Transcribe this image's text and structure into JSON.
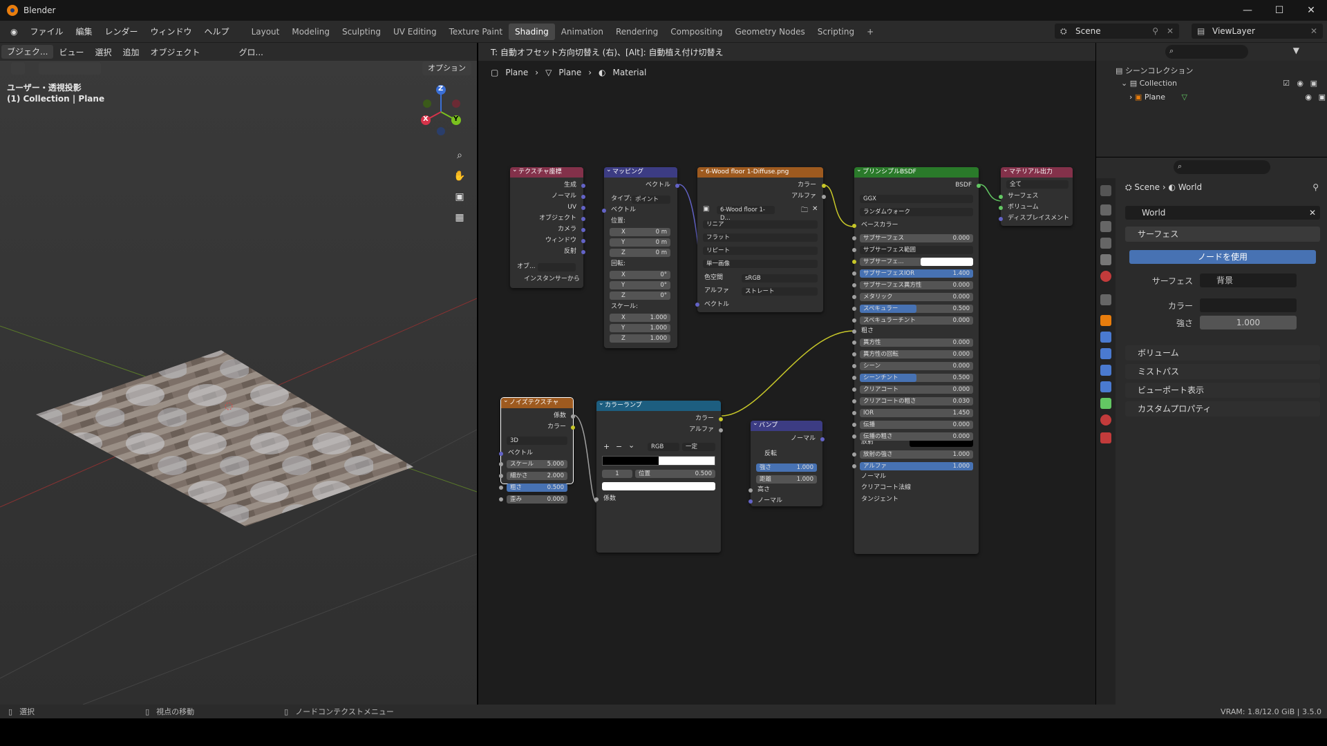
{
  "window": {
    "title": "Blender",
    "minimize": "—",
    "maximize": "☐",
    "close": "✕"
  },
  "menu": [
    "ファイル",
    "編集",
    "レンダー",
    "ウィンドウ",
    "ヘルプ"
  ],
  "workspaces": [
    {
      "label": "Layout",
      "active": false
    },
    {
      "label": "Modeling",
      "active": false
    },
    {
      "label": "Sculpting",
      "active": false
    },
    {
      "label": "UV Editing",
      "active": false
    },
    {
      "label": "Texture Paint",
      "active": false
    },
    {
      "label": "Shading",
      "active": true
    },
    {
      "label": "Animation",
      "active": false
    },
    {
      "label": "Rendering",
      "active": false
    },
    {
      "label": "Compositing",
      "active": false
    },
    {
      "label": "Geometry Nodes",
      "active": false
    },
    {
      "label": "Scripting",
      "active": false
    }
  ],
  "add_workspace": "+",
  "scene": {
    "name": "Scene",
    "view_layer": "ViewLayer"
  },
  "viewport": {
    "mode": "ブジェク...",
    "menus": [
      "ビュー",
      "選択",
      "追加",
      "オブジェクト"
    ],
    "transform": "グロ...",
    "options": "オプション",
    "view_label": "ユーザー・透視投影",
    "collection_label": "(1) Collection | Plane",
    "gizmo": {
      "z": "Z",
      "y": "Y",
      "x": "X"
    }
  },
  "node_editor": {
    "hint": "T: 自動オフセット方向切替え (右)、[Alt]: 自動植え付け切替え",
    "breadcrumb": [
      "Plane",
      "Plane",
      "Material"
    ],
    "nodes": {
      "texcoord": {
        "title": "テクスチャ座標",
        "outputs": [
          "生成",
          "ノーマル",
          "UV",
          "オブジェクト",
          "カメラ",
          "ウィンドウ",
          "反射"
        ],
        "object_label": "オブ...",
        "from_instancer": "インスタンサーから"
      },
      "mapping": {
        "title": "マッピング",
        "out": "ベクトル",
        "type_label": "タイプ:",
        "type_value": "ポイント",
        "vector": "ベクトル",
        "location": "位置:",
        "loc": [
          {
            "axis": "X",
            "val": "0 m"
          },
          {
            "axis": "Y",
            "val": "0 m"
          },
          {
            "axis": "Z",
            "val": "0 m"
          }
        ],
        "rotation": "回転:",
        "rot": [
          {
            "axis": "X",
            "val": "0°"
          },
          {
            "axis": "Y",
            "val": "0°"
          },
          {
            "axis": "Z",
            "val": "0°"
          }
        ],
        "scale": "スケール:",
        "scl": [
          {
            "axis": "X",
            "val": "1.000"
          },
          {
            "axis": "Y",
            "val": "1.000"
          },
          {
            "axis": "Z",
            "val": "1.000"
          }
        ]
      },
      "image": {
        "title": "6-Wood floor 1-Diffuse.png",
        "out_color": "カラー",
        "out_alpha": "アルファ",
        "file": "6-Wood floor 1-D...",
        "interp": "リニア",
        "proj": "フラット",
        "ext": "リピート",
        "source": "単一画像",
        "colorspace_label": "色空間",
        "colorspace": "sRGB",
        "alpha_label": "アルファ",
        "alpha": "ストレート",
        "vector": "ベクトル"
      },
      "bsdf": {
        "title": "プリンシプルBSDF",
        "out": "BSDF",
        "dist": "GGX",
        "sss_method": "ランダムウォーク",
        "base_color": "ベースカラー",
        "fields": [
          {
            "label": "サブサーフェス",
            "val": "0.000",
            "blue": false
          },
          {
            "label": "サブサーフェス範囲",
            "val": "",
            "blue": false,
            "dd": true
          },
          {
            "label": "サブサーフェ...",
            "val": "",
            "blue": false,
            "white": true
          },
          {
            "label": "サブサーフェスIOR",
            "val": "1.400",
            "blue": true
          },
          {
            "label": "サブサーフェス異方性",
            "val": "0.000",
            "blue": false
          },
          {
            "label": "メタリック",
            "val": "0.000",
            "blue": false
          },
          {
            "label": "スペキュラー",
            "val": "0.500",
            "blue": true,
            "half": true
          },
          {
            "label": "スペキュラーチント",
            "val": "0.000",
            "blue": false
          }
        ],
        "roughness": "粗さ",
        "fields2": [
          {
            "label": "異方性",
            "val": "0.000",
            "blue": false
          },
          {
            "label": "異方性の回転",
            "val": "0.000",
            "blue": false
          },
          {
            "label": "シーン",
            "val": "0.000",
            "blue": false
          },
          {
            "label": "シーンチント",
            "val": "0.500",
            "blue": true,
            "half": true
          },
          {
            "label": "クリアコート",
            "val": "0.000",
            "blue": false
          },
          {
            "label": "クリアコートの粗さ",
            "val": "0.030",
            "blue": false
          },
          {
            "label": "IOR",
            "val": "1.450",
            "blue": false
          },
          {
            "label": "伝播",
            "val": "0.000",
            "blue": false
          },
          {
            "label": "伝播の粗さ",
            "val": "0.000",
            "blue": false
          }
        ],
        "emission": "放射",
        "fields3": [
          {
            "label": "放射の強さ",
            "val": "1.000",
            "blue": false
          },
          {
            "label": "アルファ",
            "val": "1.000",
            "blue": true
          }
        ],
        "normal": "ノーマル",
        "cc_normal": "クリアコート法線",
        "tangent": "タンジェント"
      },
      "output": {
        "title": "マテリアル出力",
        "target": "全て",
        "inputs": [
          "サーフェス",
          "ボリューム",
          "ディスプレイスメント"
        ]
      },
      "noise": {
        "title": "ノイズテクスチャ",
        "out_fac": "係数",
        "out_color": "カラー",
        "dim": "3D",
        "vector": "ベクトル",
        "fields": [
          {
            "label": "スケール",
            "val": "5.000"
          },
          {
            "label": "細かさ",
            "val": "2.000"
          },
          {
            "label": "粗さ",
            "val": "0.500"
          },
          {
            "label": "歪み",
            "val": "0.000"
          }
        ]
      },
      "ramp": {
        "title": "カラーランプ",
        "out_color": "カラー",
        "out_alpha": "アルファ",
        "add": "+",
        "remove": "−",
        "menu": "⌄",
        "mode": "RGB",
        "interp": "一定",
        "index": "1",
        "pos_label": "位置",
        "pos": "0.500",
        "fac": "係数"
      },
      "bump": {
        "title": "バンプ",
        "out": "ノーマル",
        "invert": "反転",
        "strength_label": "強さ",
        "strength": "1.000",
        "distance_label": "距離",
        "distance": "1.000",
        "height": "高さ",
        "normal": "ノーマル"
      }
    }
  },
  "outliner": {
    "root": "シーンコレクション",
    "collection": "Collection",
    "object": "Plane"
  },
  "properties": {
    "breadcrumb_scene": "Scene",
    "breadcrumb_world": "World",
    "world_name": "World",
    "surface_header": "サーフェス",
    "use_nodes": "ノードを使用",
    "surface_label": "サーフェス",
    "surface_value": "背景",
    "color_label": "カラー",
    "strength_label": "強さ",
    "strength_value": "1.000",
    "sections": [
      "ボリューム",
      "ミストパス",
      "ビューポート表示",
      "カスタムプロパティ"
    ]
  },
  "status": {
    "select": "選択",
    "move_view": "視点の移動",
    "node_menu": "ノードコンテクストメニュー",
    "vram": "VRAM: 1.8/12.0 GiB | 3.5.0"
  },
  "colors": {
    "accent": "#4772b3",
    "texcoord": "#83314a",
    "mapping": "#3c3c83",
    "image": "#9e5a1f",
    "bsdf": "#2a7a2a",
    "output": "#83314a",
    "ramp": "#1d5e80"
  }
}
